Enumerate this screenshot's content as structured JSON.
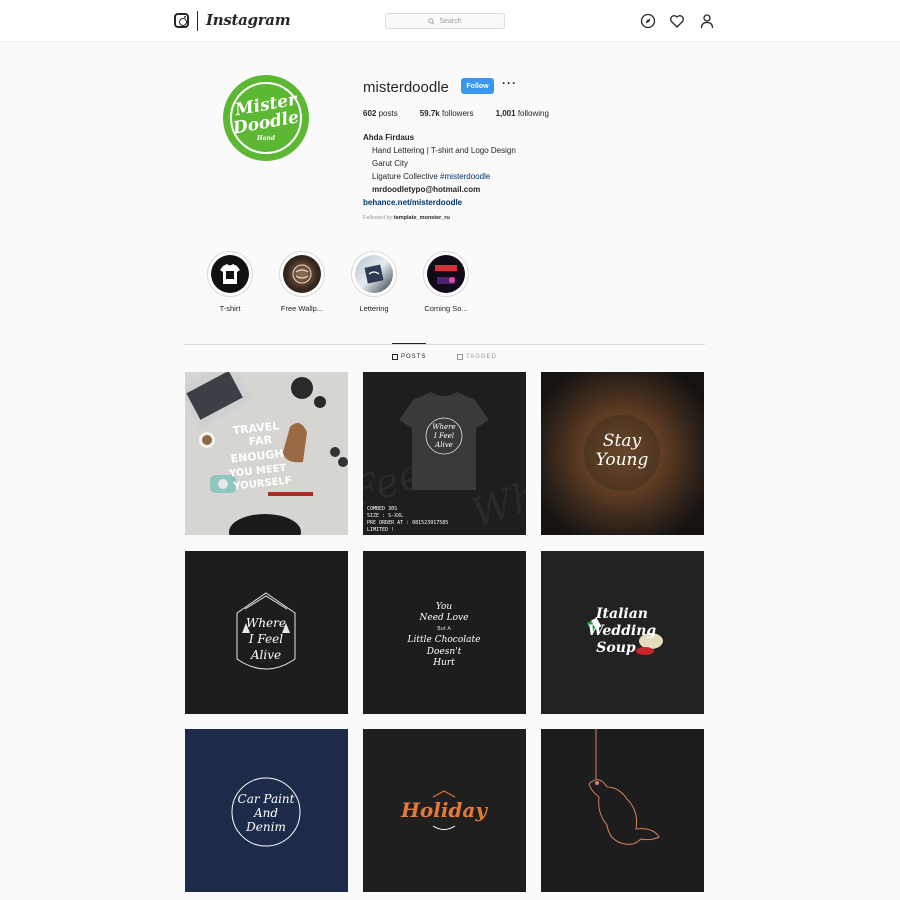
{
  "header": {
    "wordmark": "Instagram",
    "search_placeholder": "Search",
    "icons": [
      "instagram-glyph-icon",
      "compass-icon",
      "heart-icon",
      "person-icon"
    ]
  },
  "profile": {
    "username": "misterdoodle",
    "follow_label": "Follow",
    "more_label": "···",
    "avatar_text": [
      "Mister",
      "Doodle",
      "Hand"
    ],
    "stats": {
      "posts_count": "602",
      "posts_label": "posts",
      "followers_count": "59.7k",
      "followers_label": "followers",
      "following_count": "1,001",
      "following_label": "following"
    },
    "full_name": "Ahda Firdaus",
    "bio_line1": "Hand Lettering | T-shirt and Logo Design",
    "bio_line2": "Garut City",
    "bio_line3_prefix": "Ligature Collective ",
    "bio_line3_tag": "#misterdoodle",
    "email": "mrdoodletypo@hotmail.com",
    "website": "behance.net/misterdoodle",
    "followed_by_prefix": "Followed by ",
    "followed_by_user": "template_monster_ru"
  },
  "highlights": [
    {
      "label": "T-shirt"
    },
    {
      "label": "Free Wallp..."
    },
    {
      "label": "Lettering"
    },
    {
      "label": "Coming So..."
    }
  ],
  "tabs": [
    {
      "label": "POSTS",
      "active": true
    },
    {
      "label": "TAGGED",
      "active": false
    }
  ],
  "posts": [
    {
      "text": [
        "TRAVEL",
        "FAR",
        "ENOUGH",
        "YOU MEET",
        "YOURSELF"
      ]
    },
    {
      "text": [
        "Where",
        "I Feel",
        "Alive"
      ],
      "caption": [
        "COMBED 30S",
        "SIZE : S-XXL",
        "PRE ORDER AT : 081523917585",
        "LIMITED !"
      ]
    },
    {
      "text": [
        "Stay",
        "Young"
      ]
    },
    {
      "text": [
        "Where",
        "I Feel",
        "Alive"
      ]
    },
    {
      "text": [
        "You",
        "Need Love",
        "But A",
        "Little Chocolate",
        "Doesn't",
        "Hurt"
      ]
    },
    {
      "text": [
        "Italian",
        "Wedding",
        "Soup"
      ]
    },
    {
      "text": [
        "Car Paint",
        "And",
        "Denim"
      ]
    },
    {
      "text": [
        "Holiday"
      ]
    },
    {
      "text": []
    }
  ],
  "colors": {
    "follow_blue": "#3897f0",
    "avatar_green": "#5cb832",
    "link_blue": "#003569",
    "navy_post": "#1e2a4a",
    "orange_text": "#e6783a"
  }
}
